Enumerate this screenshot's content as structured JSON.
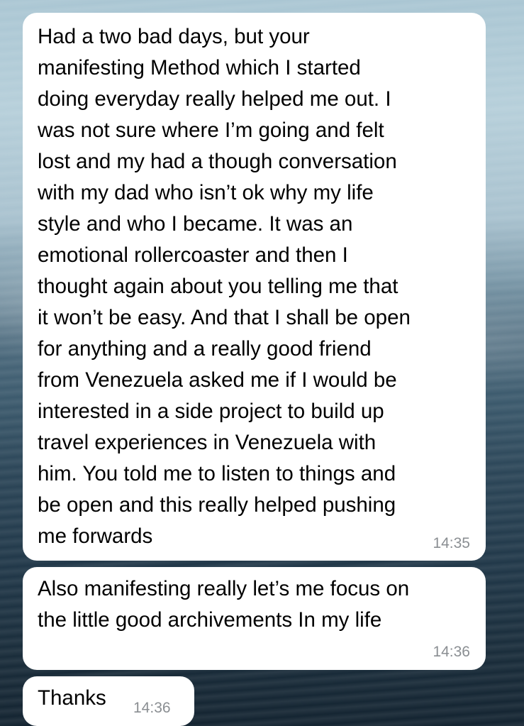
{
  "messages": [
    {
      "text": "Had a two bad days, but your\nmanifesting Method which I started\ndoing everyday really helped me out. I\nwas not sure where I’m going and felt\nlost and my had a though conversation\nwith my dad who isn’t ok why my life\nstyle and who I became. It was an\nemotional rollercoaster and then I\nthought again about you telling me that\nit won’t be easy. And that I shall be open\nfor anything and a really good friend\nfrom Venezuela asked me if I would be\ninterested in a side project to build up\ntravel experiences in Venezuela with\nhim. You told me to listen to things and\nbe open and this really helped pushing\nme forwards",
      "time": "14:35"
    },
    {
      "text": "Also manifesting really let’s me focus on\nthe little good archivements In my life",
      "time": "14:36"
    },
    {
      "text": "Thanks",
      "time": "14:36"
    }
  ],
  "colors": {
    "bubble": "#ffffff",
    "text": "#000000",
    "timestamp": "#8a8e92"
  }
}
